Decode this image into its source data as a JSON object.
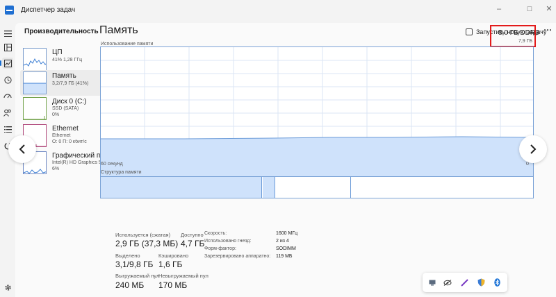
{
  "window": {
    "title": "Диспетчер задач"
  },
  "header": {
    "page_title": "Производительность",
    "run_task_label": "Запустить новую задачу",
    "more_label": "⋯"
  },
  "resources": [
    {
      "name": "ЦП",
      "sub1": "41%  1,28 ГГц",
      "sub2": ""
    },
    {
      "name": "Память",
      "sub1": "3,2/7,9 ГБ (41%)",
      "sub2": ""
    },
    {
      "name": "Диск 0 (C:)",
      "sub1": "SSD (SATA)",
      "sub2": "0%"
    },
    {
      "name": "Ethernet",
      "sub1": "Ethernet",
      "sub2": "О: 0  П: 0 кбит/с"
    },
    {
      "name": "Графический про",
      "sub1": "Intel(R) HD Graphics 520",
      "sub2": "6%"
    }
  ],
  "detail": {
    "title": "Память",
    "total": "8,0 ГБ DDR3",
    "total_sub": "7,9 ГБ",
    "usage_label": "Использование памяти",
    "time_label": "60 секунд",
    "zero_label": "0",
    "structure_label": "Структура памяти",
    "usage_fraction": 0.41
  },
  "stats": {
    "in_use_label": "Используется (сжатая)",
    "in_use_value": "2,9 ГБ (37,3 МБ)",
    "available_label": "Доступно",
    "available_value": "4,7 ГБ",
    "committed_label": "Выделено",
    "committed_value": "3,1/9,8 ГБ",
    "cached_label": "Кэшировано",
    "cached_value": "1,6 ГБ",
    "paged_label": "Выгружаемый пул",
    "paged_value": "240 МБ",
    "nonpaged_label": "Невыгружаемый пул",
    "nonpaged_value": "170 МБ"
  },
  "props": [
    {
      "label": "Скорость:",
      "value": "1600 МГц"
    },
    {
      "label": "Использовано гнезд:",
      "value": "2 из 4"
    },
    {
      "label": "Форм-фактор:",
      "value": "SODIMM"
    },
    {
      "label": "Зарезервировано аппаратно:",
      "value": "119 МБ"
    }
  ],
  "colors": {
    "accent": "#1a6fd0",
    "memory_fill": "#cfe2fb",
    "memory_line": "#6b9bd8",
    "highlight_border": "#e31b1b"
  },
  "icons": {
    "tray": [
      "display-icon",
      "hidden-eye-icon",
      "pen-icon",
      "shield-icon",
      "bluetooth-icon"
    ]
  }
}
